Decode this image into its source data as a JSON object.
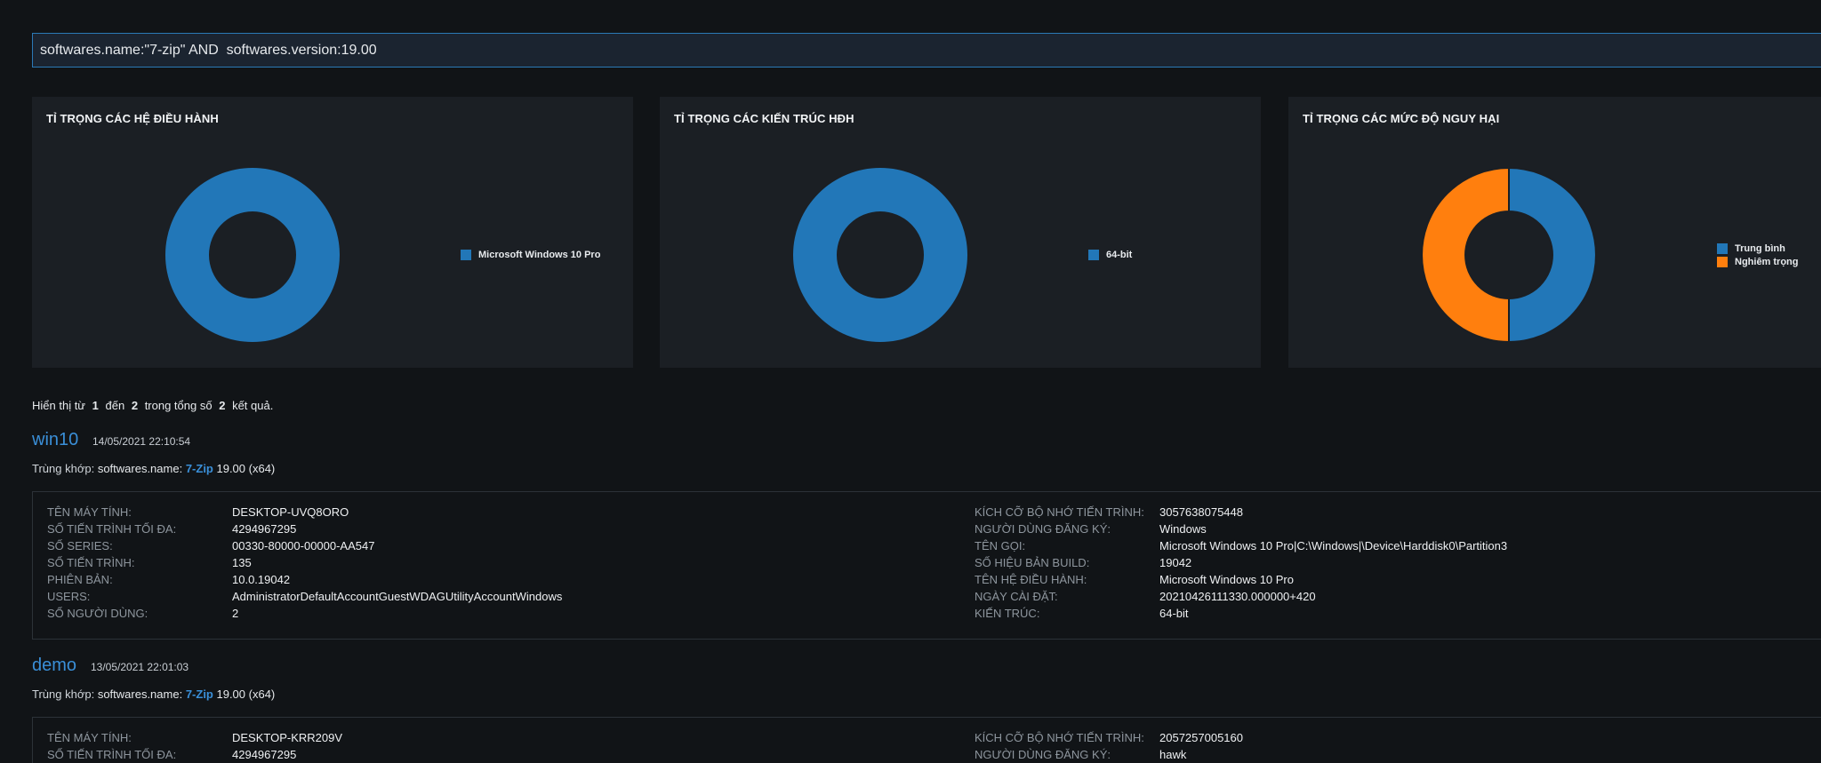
{
  "search": {
    "query": "softwares.name:\"7-zip\" AND  softwares.version:19.00"
  },
  "panels": [
    {
      "title": "TỈ TRỌNG CÁC HỆ ĐIỀU HÀNH",
      "chart_data": {
        "type": "pie",
        "labels": [
          "Microsoft Windows 10 Pro"
        ],
        "values": [
          2
        ],
        "colors": [
          "#2277b8"
        ],
        "title": "TỈ TRỌNG CÁC HỆ ĐIỀU HÀNH"
      }
    },
    {
      "title": "TỈ TRỌNG CÁC KIẾN TRÚC HĐH",
      "chart_data": {
        "type": "pie",
        "labels": [
          "64-bit"
        ],
        "values": [
          2
        ],
        "colors": [
          "#2277b8"
        ],
        "title": "TỈ TRỌNG CÁC KIẾN TRÚC HĐH"
      }
    },
    {
      "title": "TỈ TRỌNG CÁC MỨC ĐỘ NGUY HẠI",
      "chart_data": {
        "type": "pie",
        "labels": [
          "Trung bình",
          "Nghiêm trọng"
        ],
        "values": [
          1,
          1
        ],
        "colors": [
          "#2277b8",
          "#ff7f0e"
        ],
        "title": "TỈ TRỌNG CÁC MỨC ĐỘ NGUY HẠI"
      }
    }
  ],
  "summary": {
    "prefix": "Hiển thị từ",
    "from": "1",
    "to_word": "đến",
    "to": "2",
    "of_word": "trong tổng số",
    "total": "2",
    "suffix": "kết quả."
  },
  "results": [
    {
      "host": "win10",
      "date": "14/05/2021 22:10:54",
      "match_label": "Trùng khớp:",
      "match_key": "softwares.name:",
      "match_hl": "7-Zip",
      "match_rest": " 19.00 (x64)",
      "left": [
        [
          "TÊN MÁY TÍNH:",
          "DESKTOP-UVQ8ORO"
        ],
        [
          "SỐ TIẾN TRÌNH TỐI ĐA:",
          "4294967295"
        ],
        [
          "SỐ SERIES:",
          "00330-80000-00000-AA547"
        ],
        [
          "SỐ TIẾN TRÌNH:",
          "135"
        ],
        [
          "PHIÊN BẢN:",
          "10.0.19042"
        ],
        [
          "USERS:",
          "AdministratorDefaultAccountGuestWDAGUtilityAccountWindows"
        ],
        [
          "SỐ NGƯỜI DÙNG:",
          "2"
        ]
      ],
      "right": [
        [
          "KÍCH CỠ BỘ NHỚ TIẾN TRÌNH:",
          "3057638075448"
        ],
        [
          "NGƯỜI DÙNG ĐĂNG KÝ:",
          "Windows"
        ],
        [
          "TÊN GỌI:",
          "Microsoft Windows 10 Pro|C:\\Windows|\\Device\\Harddisk0\\Partition3"
        ],
        [
          "SỐ HIỆU BẢN BUILD:",
          "19042"
        ],
        [
          "TÊN HỆ ĐIỀU HÀNH:",
          "Microsoft Windows 10 Pro"
        ],
        [
          "NGÀY CÀI ĐẶT:",
          "20210426111330.000000+420"
        ],
        [
          "KIẾN TRÚC:",
          "64-bit"
        ]
      ]
    },
    {
      "host": "demo",
      "date": "13/05/2021 22:01:03",
      "match_label": "Trùng khớp:",
      "match_key": "softwares.name:",
      "match_hl": "7-Zip",
      "match_rest": " 19.00 (x64)",
      "left": [
        [
          "TÊN MÁY TÍNH:",
          "DESKTOP-KRR209V"
        ],
        [
          "SỐ TIẾN TRÌNH TỐI ĐA:",
          "4294967295"
        ]
      ],
      "right": [
        [
          "KÍCH CỠ BỘ NHỚ TIẾN TRÌNH:",
          "2057257005160"
        ],
        [
          "NGƯỜI DÙNG ĐĂNG KÝ:",
          "hawk"
        ]
      ]
    }
  ]
}
